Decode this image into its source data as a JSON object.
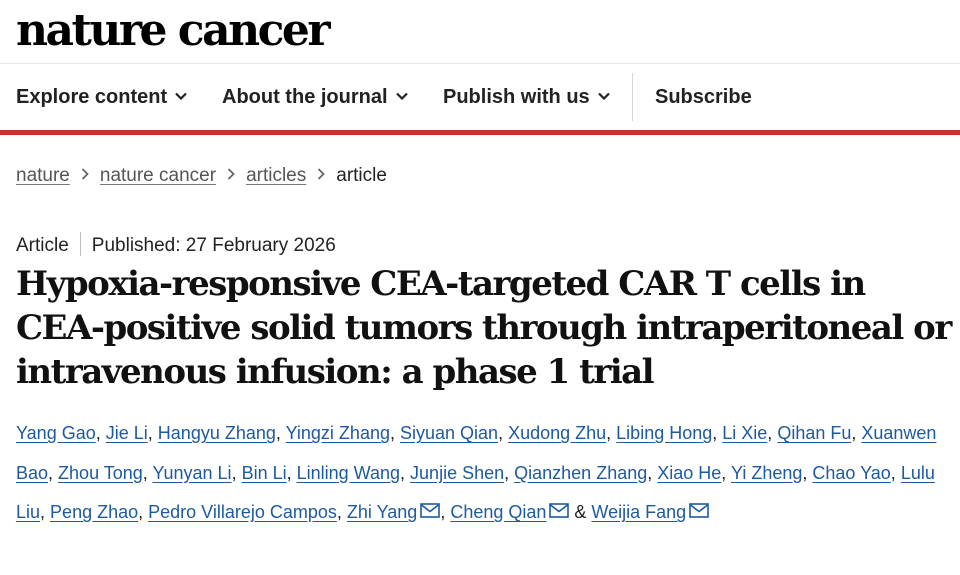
{
  "site": {
    "logo": "nature cancer"
  },
  "nav": {
    "explore": "Explore content",
    "about": "About the journal",
    "publish": "Publish with us",
    "subscribe": "Subscribe"
  },
  "breadcrumb": {
    "items": [
      "nature",
      "nature cancer",
      "articles"
    ],
    "current": "article"
  },
  "article": {
    "type": "Article",
    "published": "Published: 27 February 2026",
    "title": "Hypoxia-responsive CEA-targeted CAR T cells in CEA-positive solid tumors through intraperitoneal or intravenous infusion: a phase 1 trial",
    "authors": [
      "Yang Gao",
      "Jie Li",
      "Hangyu Zhang",
      "Yingzi Zhang",
      "Siyuan Qian",
      "Xudong Zhu",
      "Libing Hong",
      "Li Xie",
      "Qihan Fu",
      "Xuanwen Bao",
      "Zhou Tong",
      "Yunyan Li",
      "Bin Li",
      "Linling Wang",
      "Junjie Shen",
      "Qianzhen Zhang",
      "Xiao He",
      "Yi Zheng",
      "Chao Yao",
      "Lulu Liu",
      "Peng Zhao",
      "Pedro Villarejo Campos",
      "Zhi Yang",
      "Cheng Qian",
      "Weijia Fang"
    ],
    "author_separator": ", ",
    "last_separator": " & ",
    "corresponding_authors": [
      "Zhi Yang",
      "Cheng Qian",
      "Weijia Fang"
    ]
  },
  "colors": {
    "accent_red": "#c5332a",
    "author_link": "#1e5aa0"
  },
  "icons": {
    "nav_dropdown": "chevron-down-icon",
    "breadcrumb_separator": "chevron-right-icon",
    "contact": "mail-icon"
  }
}
